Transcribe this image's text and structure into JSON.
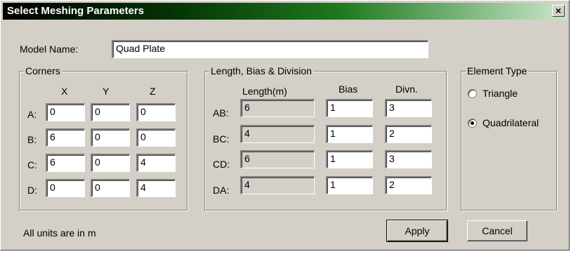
{
  "window": {
    "title": "Select Meshing Parameters",
    "close_label": "×"
  },
  "model": {
    "label": "Model Name:",
    "value": "Quad Plate"
  },
  "corners": {
    "legend": "Corners",
    "headers": [
      "X",
      "Y",
      "Z"
    ],
    "rows": [
      {
        "label": "A:",
        "x": "0",
        "y": "0",
        "z": "0"
      },
      {
        "label": "B:",
        "x": "6",
        "y": "0",
        "z": "0"
      },
      {
        "label": "C:",
        "x": "6",
        "y": "0",
        "z": "4"
      },
      {
        "label": "D:",
        "x": "0",
        "y": "0",
        "z": "4"
      }
    ]
  },
  "lbd": {
    "legend": "Length, Bias & Division",
    "headers": [
      "Length(m)",
      "Bias",
      "Divn."
    ],
    "rows": [
      {
        "label": "AB:",
        "length": "6",
        "bias": "1",
        "divn": "3"
      },
      {
        "label": "BC:",
        "length": "4",
        "bias": "1",
        "divn": "2"
      },
      {
        "label": "CD:",
        "length": "6",
        "bias": "1",
        "divn": "3"
      },
      {
        "label": "DA:",
        "length": "4",
        "bias": "1",
        "divn": "2"
      }
    ]
  },
  "element_type": {
    "legend": "Element Type",
    "options": [
      {
        "label": "Triangle",
        "selected": false
      },
      {
        "label": "Quadrilateral",
        "selected": true
      }
    ]
  },
  "footer": {
    "units_text": "All units are in  m"
  },
  "buttons": {
    "apply": "Apply",
    "cancel": "Cancel"
  }
}
